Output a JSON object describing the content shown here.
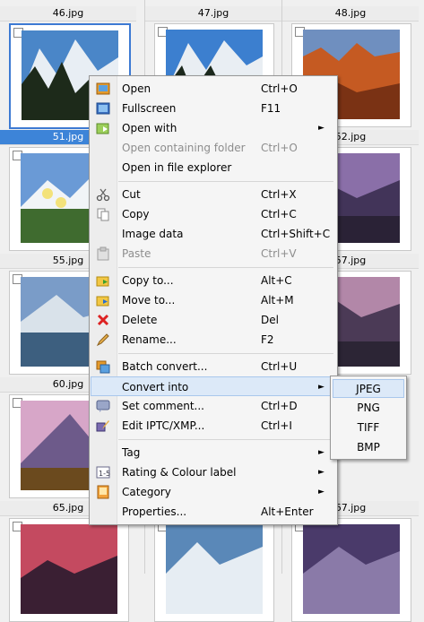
{
  "grid": {
    "labels": {
      "r0c0": "46.jpg",
      "r0c1": "47.jpg",
      "r0c2": "48.jpg",
      "r1c0": "51.jpg",
      "r1c2": "52.jpg",
      "r2c0": "55.jpg",
      "r2c2": "57.jpg",
      "r3c0": "60.jpg",
      "r4c0": "65.jpg",
      "r4c2": "67.jpg"
    }
  },
  "menu": {
    "items": [
      {
        "label": "Open",
        "shortcut": "Ctrl+O",
        "icon": "open-image-icon"
      },
      {
        "label": "Fullscreen",
        "shortcut": "F11",
        "icon": "fullscreen-icon"
      },
      {
        "label": "Open with",
        "shortcut": "",
        "icon": "open-with-icon",
        "arrow": "►"
      },
      {
        "label": "Open containing folder",
        "shortcut": "Ctrl+O",
        "icon": "",
        "disabled": true
      },
      {
        "label": "Open in file explorer",
        "shortcut": "",
        "icon": ""
      },
      {
        "label": "Cut",
        "shortcut": "Ctrl+X",
        "icon": "scissors-icon"
      },
      {
        "label": "Copy",
        "shortcut": "Ctrl+C",
        "icon": "copy-icon"
      },
      {
        "label": "Image data",
        "shortcut": "Ctrl+Shift+C",
        "icon": ""
      },
      {
        "label": "Paste",
        "shortcut": "Ctrl+V",
        "icon": "paste-icon",
        "disabled": true
      },
      {
        "label": "Copy to...",
        "shortcut": "Alt+C",
        "icon": "copy-to-icon"
      },
      {
        "label": "Move to...",
        "shortcut": "Alt+M",
        "icon": "move-to-icon"
      },
      {
        "label": "Delete",
        "shortcut": "Del",
        "icon": "delete-icon"
      },
      {
        "label": "Rename...",
        "shortcut": "F2",
        "icon": "rename-icon"
      },
      {
        "label": "Batch convert...",
        "shortcut": "Ctrl+U",
        "icon": "batch-convert-icon"
      },
      {
        "label": "Convert into",
        "shortcut": "",
        "icon": "",
        "arrow": "►"
      },
      {
        "label": "Set comment...",
        "shortcut": "Ctrl+D",
        "icon": "comment-icon"
      },
      {
        "label": "Edit IPTC/XMP...",
        "shortcut": "Ctrl+I",
        "icon": "edit-iptc-icon"
      },
      {
        "label": "Tag",
        "shortcut": "",
        "icon": "",
        "arrow": "►"
      },
      {
        "label": "Rating & Colour label",
        "shortcut": "",
        "icon": "rating-icon",
        "arrow": "►"
      },
      {
        "label": "Category",
        "shortcut": "",
        "icon": "category-icon",
        "arrow": "►"
      },
      {
        "label": "Properties...",
        "shortcut": "Alt+Enter",
        "icon": ""
      }
    ]
  },
  "submenu": {
    "items": [
      "JPEG",
      "PNG",
      "TIFF",
      "BMP"
    ]
  },
  "colors": {
    "selection": "#3d84d8",
    "menu_highlight": "#dce9f8"
  }
}
